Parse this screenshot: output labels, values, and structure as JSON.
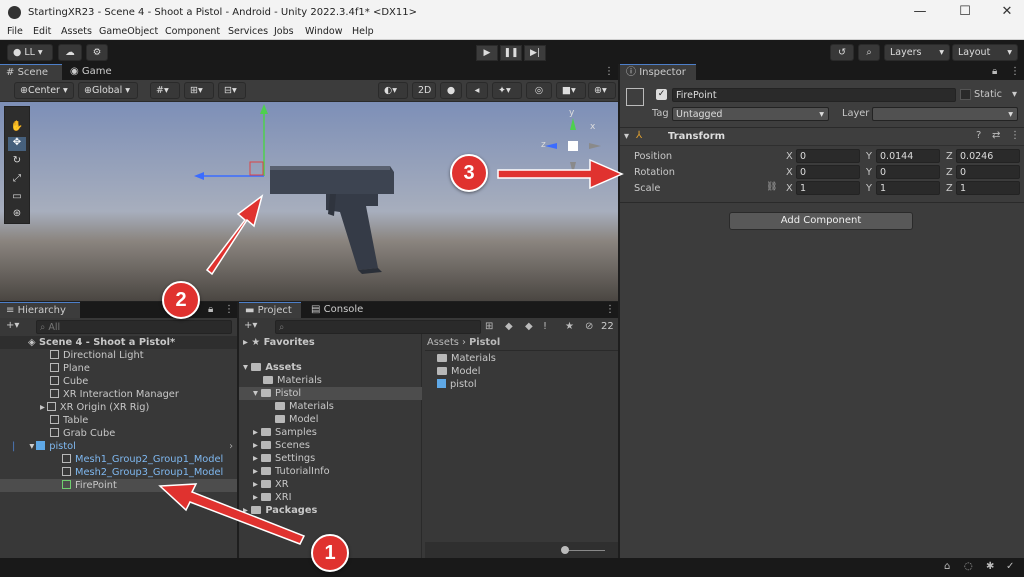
{
  "window": {
    "title": "StartingXR23 - Scene 4 - Shoot a Pistol - Android - Unity 2022.3.4f1* <DX11>",
    "minimize": "—",
    "maximize": "☐",
    "close": "✕"
  },
  "menu": [
    "File",
    "Edit",
    "Assets",
    "GameObject",
    "Component",
    "Services",
    "Jobs",
    "Window",
    "Help"
  ],
  "toolbar": {
    "account": "LL ▾",
    "layers": "Layers",
    "layout": "Layout"
  },
  "scene": {
    "tabs": [
      "Scene",
      "Game"
    ],
    "pivot": "Center",
    "space": "Global",
    "mode2d": "2D",
    "gizmo_labels": {
      "y": "y",
      "z": "z",
      "x": "x"
    }
  },
  "hierarchy": {
    "tab": "Hierarchy",
    "search_placeholder": "All",
    "scene": "Scene 4 - Shoot a Pistol*",
    "items": [
      "Directional Light",
      "Plane",
      "Cube",
      "XR Interaction Manager",
      "XR Origin (XR Rig)",
      "Table",
      "Grab Cube",
      "pistol",
      "Mesh1_Group2_Group1_Model",
      "Mesh2_Group3_Group1_Model",
      "FirePoint"
    ]
  },
  "project": {
    "tabs": [
      "Project",
      "Console"
    ],
    "hidden_count": "22",
    "tree": {
      "favorites": "Favorites",
      "assets": "Assets",
      "children": [
        "Materials",
        "Pistol",
        "Materials",
        "Model",
        "Samples",
        "Scenes",
        "Settings",
        "TutorialInfo",
        "XR",
        "XRI"
      ],
      "packages": "Packages"
    },
    "breadcrumb": [
      "Assets",
      "Pistol"
    ],
    "contents": [
      "Materials",
      "Model",
      "pistol"
    ]
  },
  "inspector": {
    "tab": "Inspector",
    "object_name": "FirePoint",
    "static_label": "Static",
    "tag_label": "Tag",
    "tag_value": "Untagged",
    "layer_label": "Layer",
    "layer_value": "",
    "component": "Transform",
    "position_label": "Position",
    "rotation_label": "Rotation",
    "scale_label": "Scale",
    "position": {
      "x": "0",
      "y": "0.0144",
      "z": "0.0246"
    },
    "rotation": {
      "x": "0",
      "y": "0",
      "z": "0"
    },
    "scale": {
      "x": "1",
      "y": "1",
      "z": "1"
    },
    "add_component": "Add Component"
  },
  "annotations": {
    "one": "1",
    "two": "2",
    "three": "3"
  },
  "colors": {
    "accent_red": "#e0322f",
    "selection": "#4d4d4d",
    "blue_text": "#7fb8f0"
  }
}
